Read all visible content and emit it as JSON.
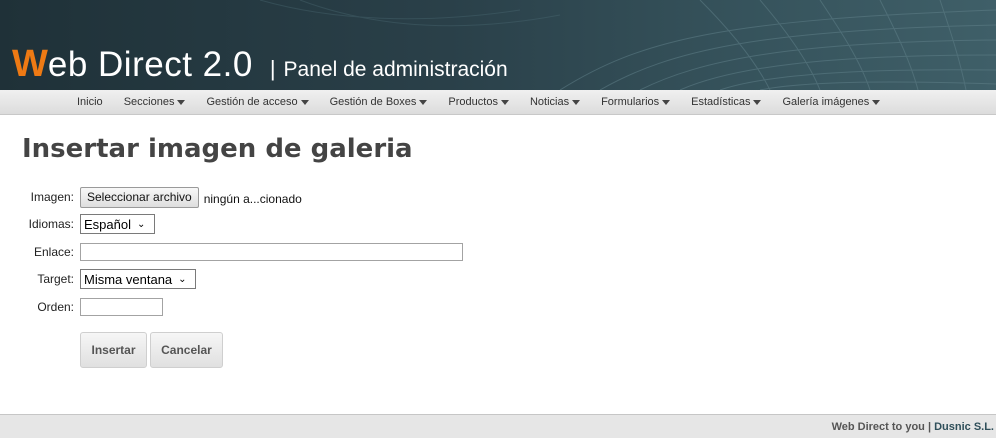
{
  "header": {
    "brand_first_letter": "W",
    "brand_rest": "eb Direct 2.0",
    "separator": "|",
    "subtitle": "Panel de administración"
  },
  "nav": {
    "items": [
      {
        "label": "Inicio",
        "dropdown": false
      },
      {
        "label": "Secciones",
        "dropdown": true
      },
      {
        "label": "Gestión de acceso",
        "dropdown": true
      },
      {
        "label": "Gestión de Boxes",
        "dropdown": true
      },
      {
        "label": "Productos",
        "dropdown": true
      },
      {
        "label": "Noticias",
        "dropdown": true
      },
      {
        "label": "Formularios",
        "dropdown": true
      },
      {
        "label": "Estadísticas",
        "dropdown": true
      },
      {
        "label": "Galería imágenes",
        "dropdown": true
      }
    ]
  },
  "page": {
    "title": "Insertar imagen de galeria"
  },
  "form": {
    "imagen_label": "Imagen:",
    "file_button": "Seleccionar archivo",
    "file_status": "ningún a...cionado",
    "idiomas_label": "Idiomas:",
    "idiomas_value": "Español",
    "enlace_label": "Enlace:",
    "enlace_value": "",
    "target_label": "Target:",
    "target_value": "Misma ventana",
    "orden_label": "Orden:",
    "orden_value": "",
    "insert_button": "Insertar",
    "cancel_button": "Cancelar"
  },
  "footer": {
    "text": "Web Direct to you |",
    "company": "Dusnic S.L."
  },
  "colors": {
    "brand_accent": "#ee7a14",
    "header_bg": "#2a4049"
  }
}
